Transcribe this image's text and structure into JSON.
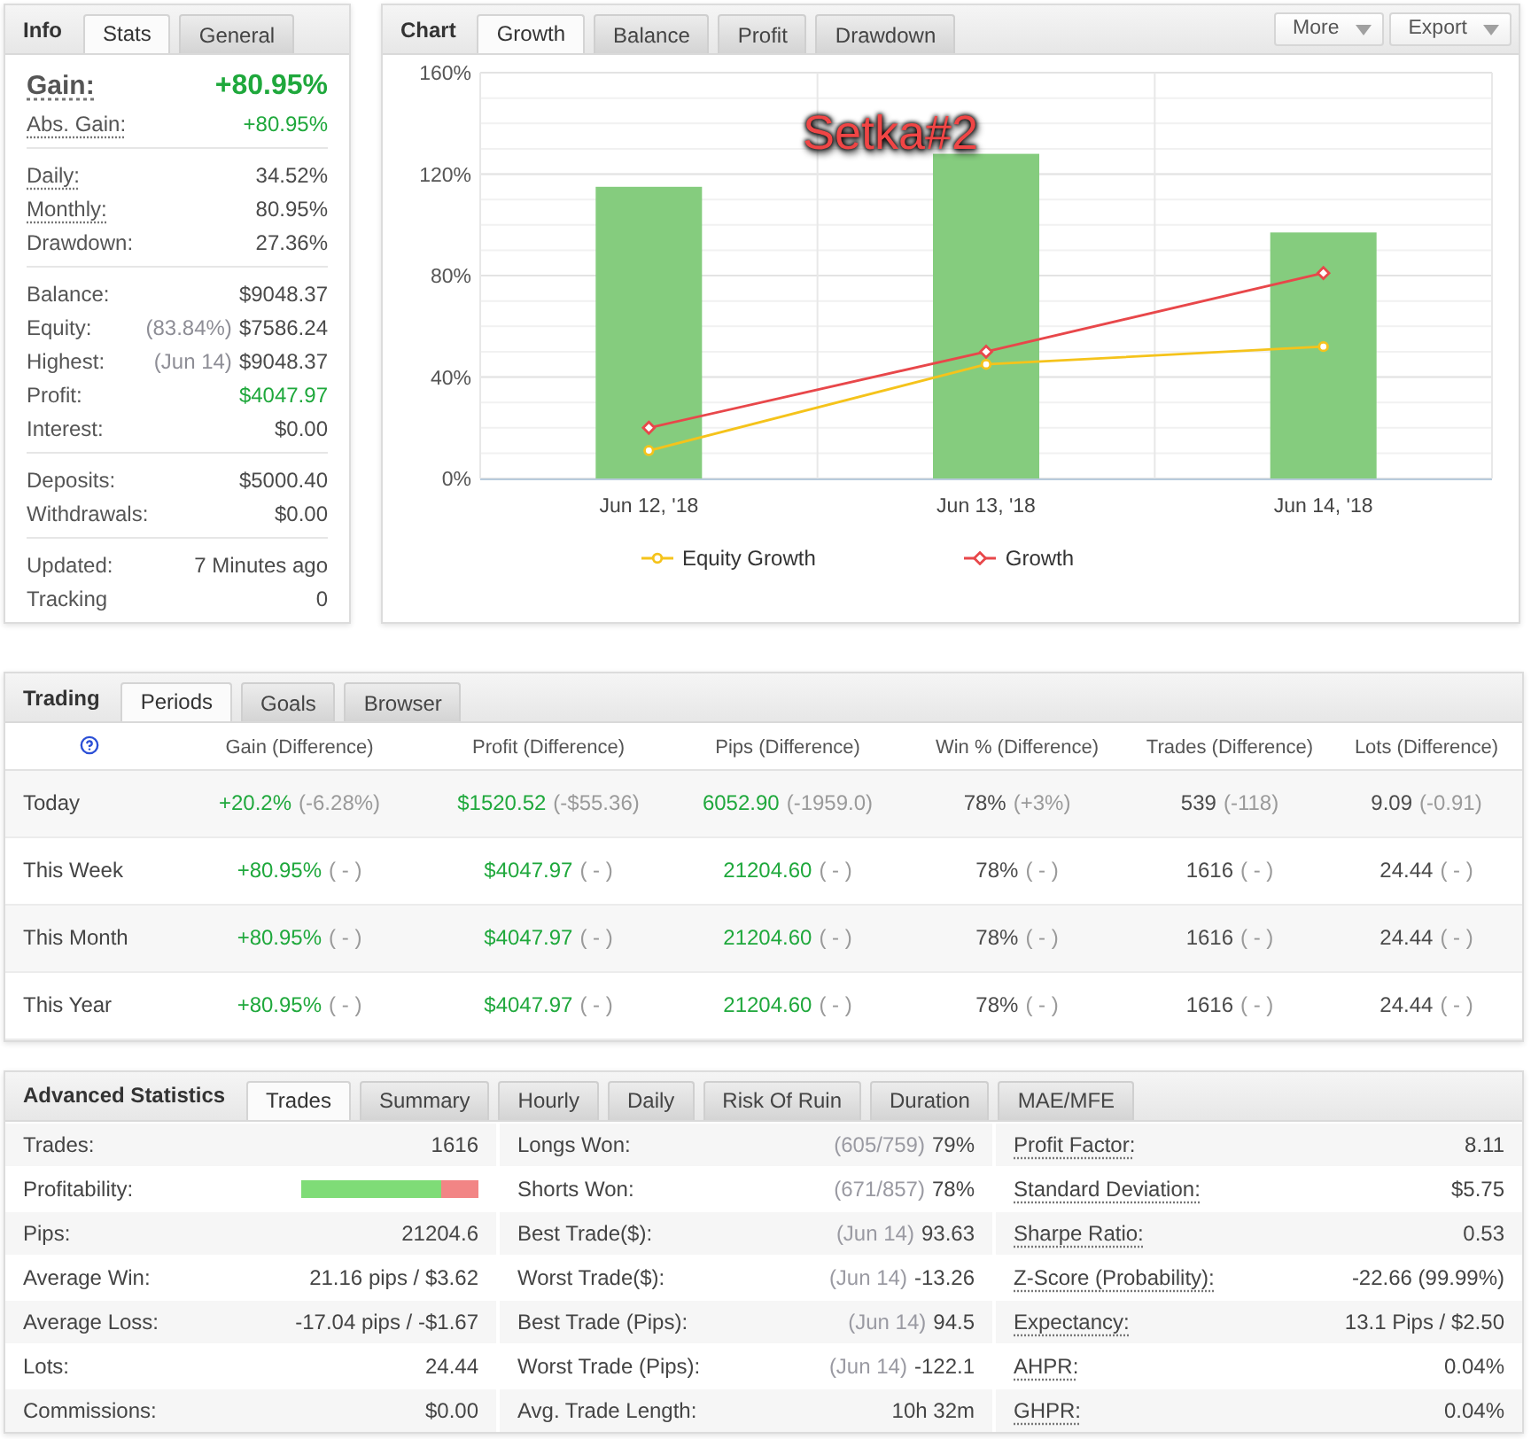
{
  "info": {
    "title": "Info",
    "tabs": [
      {
        "label": "Stats",
        "selected": true
      },
      {
        "label": "General",
        "selected": false
      }
    ],
    "sections": [
      {
        "rows": [
          {
            "kind": "headline",
            "label": "Gain:",
            "dotted": true,
            "value": "+80.95%",
            "positive": true
          },
          {
            "kind": "stat",
            "label": "Abs. Gain:",
            "dotted": true,
            "value": "+80.95%",
            "positive": true
          }
        ]
      },
      {
        "rows": [
          {
            "kind": "stat",
            "label": "Daily:",
            "dotted": true,
            "value": "34.52%",
            "positive": false
          },
          {
            "kind": "stat",
            "label": "Monthly:",
            "dotted": true,
            "value": "80.95%",
            "positive": false
          },
          {
            "kind": "stat",
            "label": "Drawdown:",
            "dotted": false,
            "value": "27.36%",
            "positive": false
          }
        ]
      },
      {
        "rows": [
          {
            "kind": "stat",
            "label": "Balance:",
            "dotted": false,
            "value": "$9048.37",
            "positive": false
          },
          {
            "kind": "stat",
            "label": "Equity:",
            "dotted": false,
            "note": "(83.84%)",
            "value": "$7586.24",
            "positive": false
          },
          {
            "kind": "stat",
            "label": "Highest:",
            "dotted": false,
            "note": "(Jun 14)",
            "value": "$9048.37",
            "positive": false
          },
          {
            "kind": "stat",
            "label": "Profit:",
            "dotted": false,
            "value": "$4047.97",
            "positive": true
          },
          {
            "kind": "stat",
            "label": "Interest:",
            "dotted": false,
            "value": "$0.00",
            "positive": false
          }
        ]
      },
      {
        "rows": [
          {
            "kind": "stat",
            "label": "Deposits:",
            "dotted": false,
            "value": "$5000.40",
            "positive": false
          },
          {
            "kind": "stat",
            "label": "Withdrawals:",
            "dotted": false,
            "value": "$0.00",
            "positive": false
          }
        ]
      },
      {
        "rows": [
          {
            "kind": "stat",
            "label": "Updated:",
            "dotted": false,
            "value": "7 Minutes ago",
            "positive": false
          },
          {
            "kind": "stat",
            "label": "Tracking",
            "dotted": false,
            "value": "0",
            "positive": false
          }
        ]
      }
    ]
  },
  "chart": {
    "title": "Chart",
    "tabs": [
      {
        "label": "Growth",
        "selected": true
      },
      {
        "label": "Balance",
        "selected": false
      },
      {
        "label": "Profit",
        "selected": false
      },
      {
        "label": "Drawdown",
        "selected": false
      }
    ],
    "menus": [
      "More",
      "Export"
    ],
    "overlay_label": "Setka#2",
    "chart_data": {
      "type": "bar",
      "grid": true,
      "categories": [
        "Jun 12, '18",
        "Jun 13, '18",
        "Jun 14, '18"
      ],
      "ylim": [
        0,
        160
      ],
      "yticks": [
        {
          "value": 0,
          "label": "0%"
        },
        {
          "value": 40,
          "label": "40%"
        },
        {
          "value": 80,
          "label": "80%"
        },
        {
          "value": 120,
          "label": "120%"
        },
        {
          "value": 160,
          "label": "160%"
        }
      ],
      "series": [
        {
          "type": "bar",
          "color": "#85cc7e",
          "values": [
            115,
            128,
            97
          ]
        },
        {
          "type": "line",
          "name": "Equity Growth",
          "marker": "circle",
          "color": "#f5c31b",
          "values": [
            11,
            45,
            52
          ]
        },
        {
          "type": "line",
          "name": "Growth",
          "marker": "diamond",
          "color": "#e8474a",
          "values": [
            20,
            50,
            81
          ]
        }
      ]
    }
  },
  "trading": {
    "title": "Trading",
    "tabs": [
      {
        "label": "Periods",
        "selected": true
      },
      {
        "label": "Goals",
        "selected": false
      },
      {
        "label": "Browser",
        "selected": false
      }
    ],
    "columns": [
      {
        "label": "Gain (Difference)",
        "positive": true
      },
      {
        "label": "Profit (Difference)",
        "positive": true
      },
      {
        "label": "Pips (Difference)",
        "positive": true
      },
      {
        "label": "Win % (Difference)",
        "positive": false
      },
      {
        "label": "Trades (Difference)",
        "positive": false
      },
      {
        "label": "Lots (Difference)",
        "positive": false
      }
    ],
    "rows": [
      {
        "period": "Today",
        "cells": [
          {
            "value": "+20.2%",
            "difference": "(-6.28%)"
          },
          {
            "value": "$1520.52",
            "difference": "(-$55.36)"
          },
          {
            "value": "6052.90",
            "difference": "(-1959.0)"
          },
          {
            "value": "78%",
            "difference": "(+3%)"
          },
          {
            "value": "539",
            "difference": "(-118)"
          },
          {
            "value": "9.09",
            "difference": "(-0.91)"
          }
        ]
      },
      {
        "period": "This Week",
        "cells": [
          {
            "value": "+80.95%",
            "difference": "( - )"
          },
          {
            "value": "$4047.97",
            "difference": "( - )"
          },
          {
            "value": "21204.60",
            "difference": "( - )"
          },
          {
            "value": "78%",
            "difference": "( - )"
          },
          {
            "value": "1616",
            "difference": "( - )"
          },
          {
            "value": "24.44",
            "difference": "( - )"
          }
        ]
      },
      {
        "period": "This Month",
        "cells": [
          {
            "value": "+80.95%",
            "difference": "( - )"
          },
          {
            "value": "$4047.97",
            "difference": "( - )"
          },
          {
            "value": "21204.60",
            "difference": "( - )"
          },
          {
            "value": "78%",
            "difference": "( - )"
          },
          {
            "value": "1616",
            "difference": "( - )"
          },
          {
            "value": "24.44",
            "difference": "( - )"
          }
        ]
      },
      {
        "period": "This Year",
        "cells": [
          {
            "value": "+80.95%",
            "difference": "( - )"
          },
          {
            "value": "$4047.97",
            "difference": "( - )"
          },
          {
            "value": "21204.60",
            "difference": "( - )"
          },
          {
            "value": "78%",
            "difference": "( - )"
          },
          {
            "value": "1616",
            "difference": "( - )"
          },
          {
            "value": "24.44",
            "difference": "( - )"
          }
        ]
      }
    ]
  },
  "advanced": {
    "title": "Advanced Statistics",
    "tabs": [
      {
        "label": "Trades",
        "selected": true
      },
      {
        "label": "Summary",
        "selected": false
      },
      {
        "label": "Hourly",
        "selected": false
      },
      {
        "label": "Daily",
        "selected": false
      },
      {
        "label": "Risk Of Ruin",
        "selected": false
      },
      {
        "label": "Duration",
        "selected": false
      },
      {
        "label": "MAE/MFE",
        "selected": false
      }
    ],
    "columns": [
      {
        "rows": [
          {
            "kind": "text",
            "label": "Trades:",
            "dotted": false,
            "value": "1616"
          },
          {
            "kind": "bar",
            "label": "Profitability:",
            "dotted": false,
            "level": 0.79
          },
          {
            "kind": "text",
            "label": "Pips:",
            "dotted": false,
            "value": "21204.6"
          },
          {
            "kind": "text",
            "label": "Average Win:",
            "dotted": false,
            "value": "21.16 pips / $3.62"
          },
          {
            "kind": "text",
            "label": "Average Loss:",
            "dotted": false,
            "value": "-17.04 pips / -$1.67"
          },
          {
            "kind": "text",
            "label": "Lots:",
            "dotted": false,
            "value": "24.44"
          },
          {
            "kind": "text",
            "label": "Commissions:",
            "dotted": false,
            "value": "$0.00"
          }
        ]
      },
      {
        "rows": [
          {
            "kind": "text",
            "label": "Longs Won:",
            "dotted": false,
            "note": "(605/759)",
            "value": "79%"
          },
          {
            "kind": "text",
            "label": "Shorts Won:",
            "dotted": false,
            "note": "(671/857)",
            "value": "78%"
          },
          {
            "kind": "text",
            "label": "Best Trade($):",
            "dotted": false,
            "note": "(Jun 14)",
            "value": "93.63"
          },
          {
            "kind": "text",
            "label": "Worst Trade($):",
            "dotted": false,
            "note": "(Jun 14)",
            "value": "-13.26"
          },
          {
            "kind": "text",
            "label": "Best Trade (Pips):",
            "dotted": false,
            "note": "(Jun 14)",
            "value": "94.5"
          },
          {
            "kind": "text",
            "label": "Worst Trade (Pips):",
            "dotted": false,
            "note": "(Jun 14)",
            "value": "-122.1"
          },
          {
            "kind": "text",
            "label": "Avg. Trade Length:",
            "dotted": false,
            "value": "10h 32m"
          }
        ]
      },
      {
        "rows": [
          {
            "kind": "text",
            "label": "Profit Factor:",
            "dotted": true,
            "value": "8.11"
          },
          {
            "kind": "text",
            "label": "Standard Deviation:",
            "dotted": true,
            "value": "$5.75"
          },
          {
            "kind": "text",
            "label": "Sharpe Ratio:",
            "dotted": true,
            "value": "0.53"
          },
          {
            "kind": "text",
            "label": "Z-Score (Probability):",
            "dotted": true,
            "value": "-22.66 (99.99%)"
          },
          {
            "kind": "text",
            "label": "Expectancy:",
            "dotted": true,
            "value": "13.1 Pips / $2.50"
          },
          {
            "kind": "text",
            "label": "AHPR:",
            "dotted": true,
            "value": "0.04%"
          },
          {
            "kind": "text",
            "label": "GHPR:",
            "dotted": true,
            "value": "0.04%"
          }
        ]
      }
    ]
  }
}
